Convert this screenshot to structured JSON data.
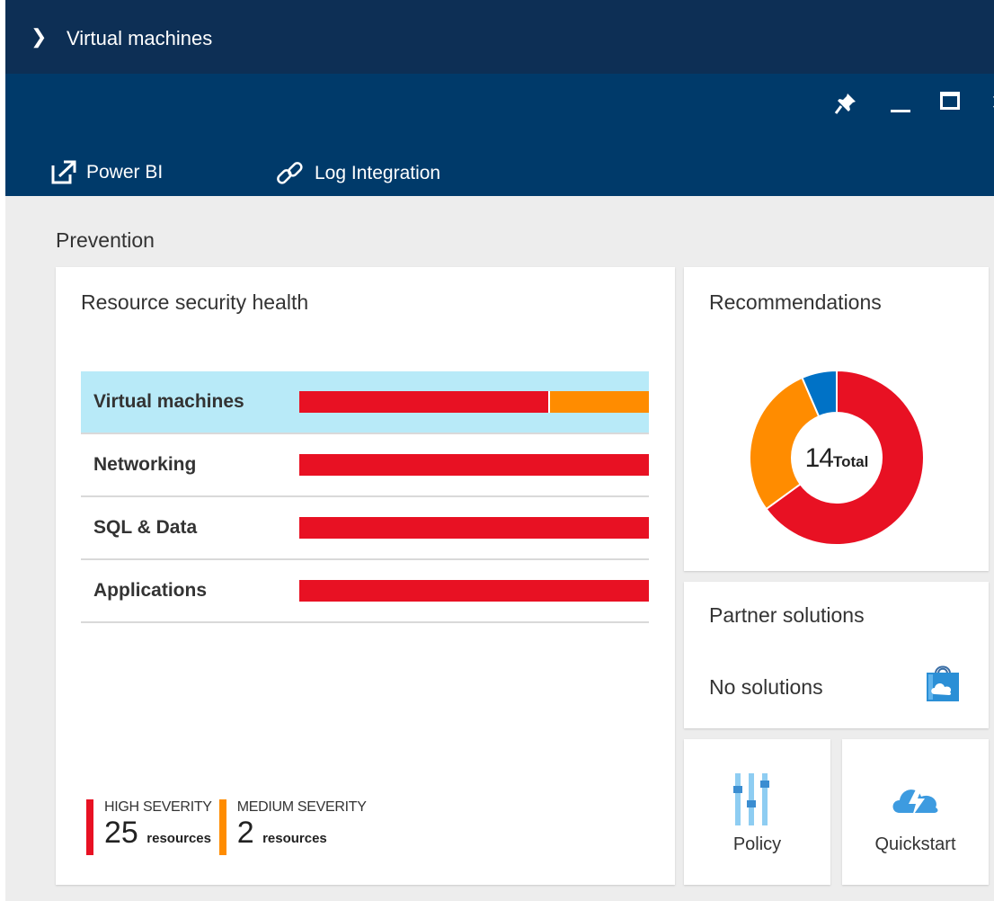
{
  "header": {
    "title": "Virtual machines"
  },
  "toolbar": {
    "power_bi": "Power BI",
    "log_integration": "Log Integration"
  },
  "section": {
    "title": "Prevention"
  },
  "resource_health": {
    "title": "Resource security health",
    "rows": [
      {
        "label": "Virtual machines",
        "high_fraction": 0.715,
        "medium_fraction": 0.285
      },
      {
        "label": "Networking",
        "high_fraction": 1.0,
        "medium_fraction": 0
      },
      {
        "label": "SQL & Data",
        "high_fraction": 1.0,
        "medium_fraction": 0
      },
      {
        "label": "Applications",
        "high_fraction": 1.0,
        "medium_fraction": 0
      }
    ],
    "legend": {
      "high": {
        "label": "HIGH SEVERITY",
        "count": "25",
        "unit": "resources"
      },
      "medium": {
        "label": "MEDIUM SEVERITY",
        "count": "2",
        "unit": "resources"
      }
    }
  },
  "recommendations": {
    "title": "Recommendations",
    "total": "14",
    "total_label": "Total",
    "segments": [
      {
        "color": "#e81123",
        "fraction": 0.65
      },
      {
        "color": "#ff8c00",
        "fraction": 0.285
      },
      {
        "color": "#0072c6",
        "fraction": 0.065
      }
    ]
  },
  "partner": {
    "title": "Partner solutions",
    "status": "No solutions"
  },
  "tiles": {
    "policy": "Policy",
    "quickstart": "Quickstart"
  },
  "colors": {
    "high": "#e81123",
    "medium": "#ff8c00",
    "selected_row": "#b8eaf8"
  }
}
